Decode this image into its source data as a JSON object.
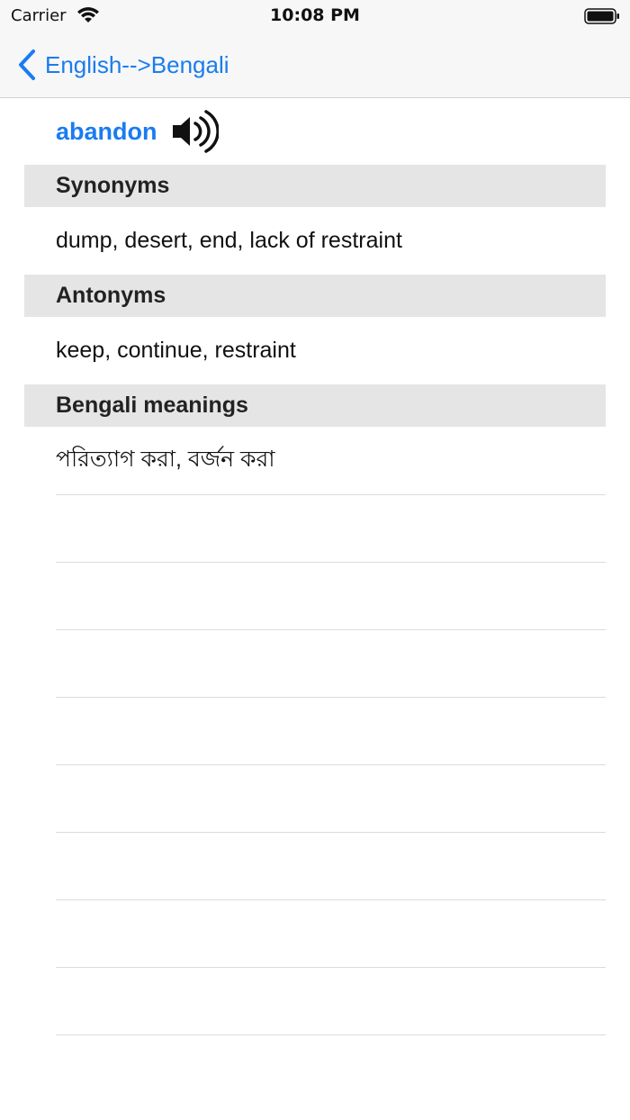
{
  "status_bar": {
    "carrier": "Carrier",
    "time": "10:08 PM",
    "icons": [
      "wifi-icon",
      "battery-icon"
    ]
  },
  "nav": {
    "back_label": "English-->Bengali",
    "back_icon": "chevron-left-icon",
    "accent_color": "#1a7cf0"
  },
  "entry": {
    "word": "abandon",
    "audio_icon": "speaker-icon",
    "sections": [
      {
        "header": "Synonyms",
        "body": "dump, desert, end, lack of restraint"
      },
      {
        "header": "Antonyms",
        "body": "keep, continue, restraint"
      },
      {
        "header": "Bengali meanings",
        "body": "পরিত্যাগ করা, বর্জন করা"
      }
    ]
  },
  "colors": {
    "header_bg": "#e5e5e5",
    "bar_bg": "#f7f7f7",
    "separator": "#dcdcdc"
  }
}
